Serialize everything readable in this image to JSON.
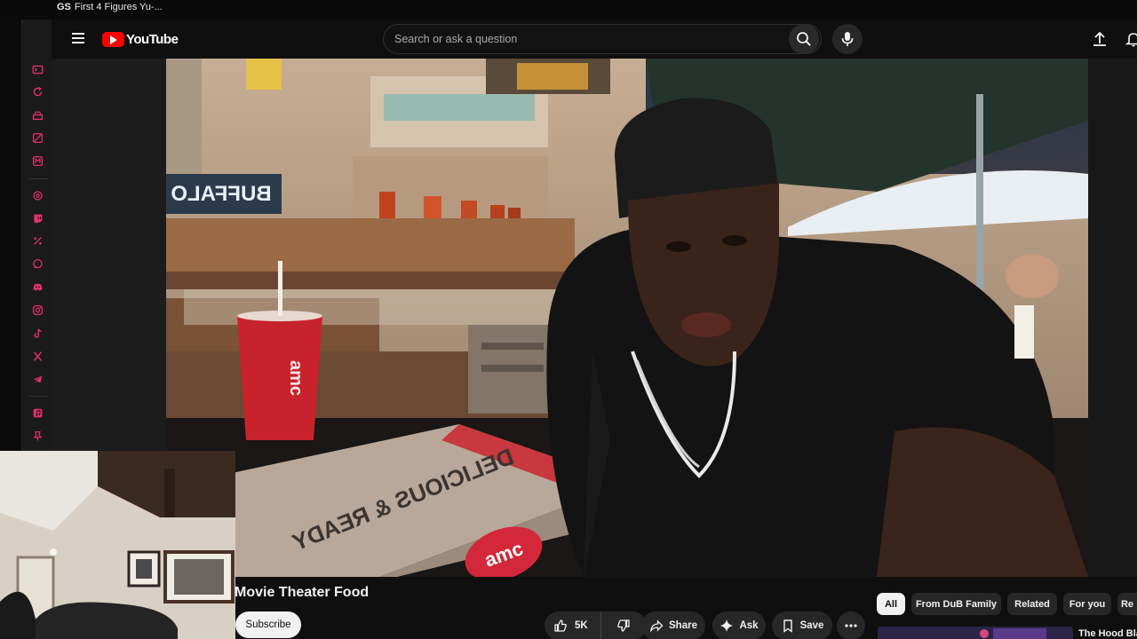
{
  "os": {
    "badge": "GS",
    "window_title": "First 4 Figures Yu-..."
  },
  "header": {
    "logo_text": "YouTube",
    "search_placeholder": "Search or ask a question"
  },
  "video": {
    "title": "Movie Theater Food",
    "scene_text": {
      "sign": "BUFFALO",
      "cup": "amc",
      "box_text": "DELICIOUS & READY",
      "box_logo": "amc"
    }
  },
  "channel": {
    "subscribe_label": "Subscribe"
  },
  "actions": {
    "likes": "5K",
    "share_label": "Share",
    "ask_label": "Ask",
    "save_label": "Save"
  },
  "chips": [
    "All",
    "From DuB Family",
    "Related",
    "For you",
    "Re"
  ],
  "recommendation": {
    "title": "The Hood Bla"
  },
  "colors": {
    "brand": "#ff0000",
    "rail_icons": "#e4306c",
    "background": "#0f0f0f"
  },
  "rail_icons": [
    "console-icon",
    "refresh-icon",
    "cake-icon",
    "ban-icon",
    "mail-icon",
    "threads-icon",
    "twitch-icon",
    "percent-icon",
    "whatsapp-icon",
    "discord-icon",
    "instagram-icon",
    "tiktok-icon",
    "x-icon",
    "telegram-icon",
    "music-icon",
    "pin-icon"
  ]
}
